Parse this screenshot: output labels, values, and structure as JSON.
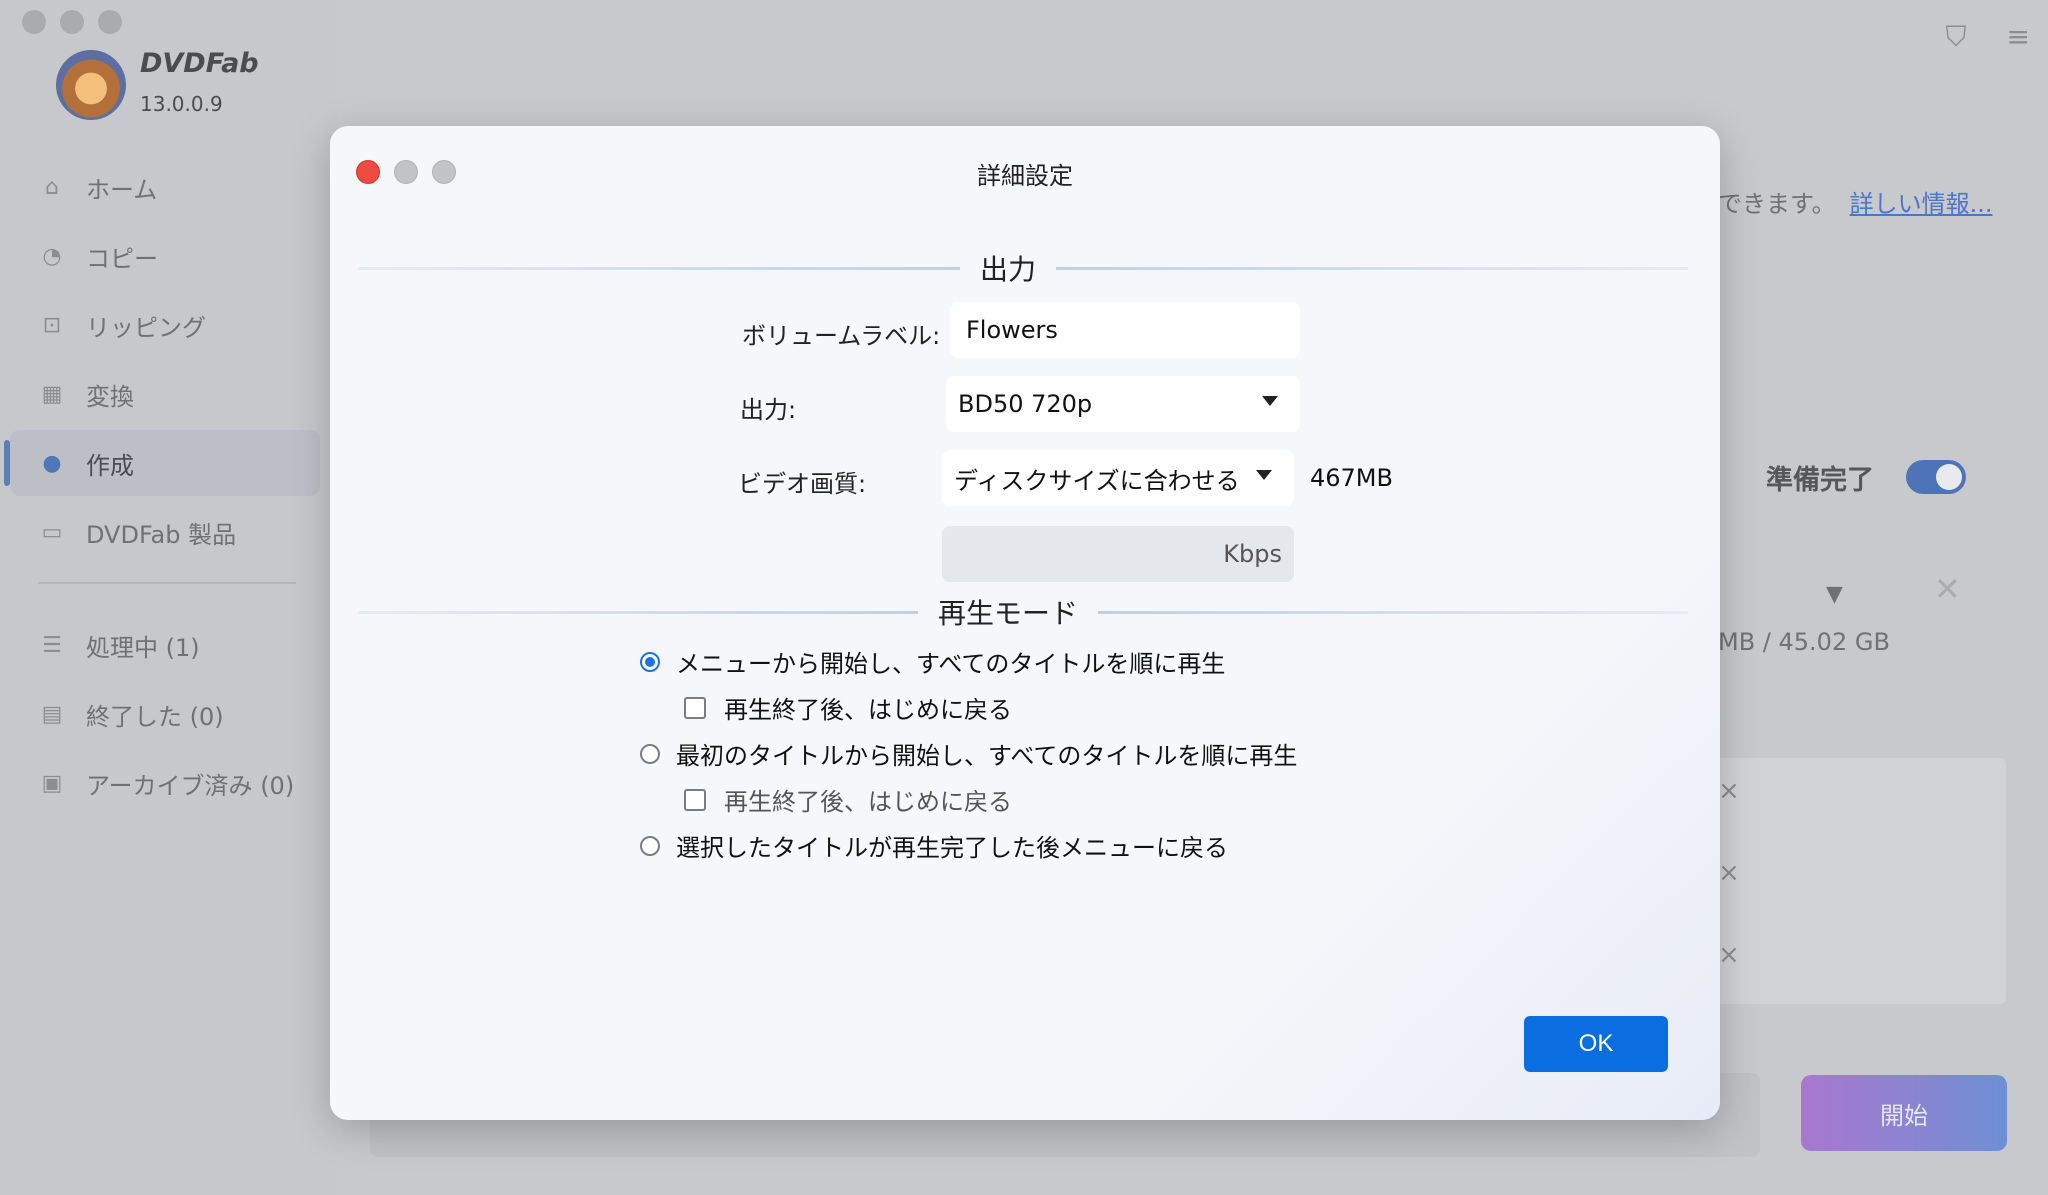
{
  "app": {
    "brand": "DVDFab",
    "version": "13.0.0.9",
    "nav": [
      {
        "label": "ホーム",
        "icon": "⌂"
      },
      {
        "label": "コピー",
        "icon": "◔"
      },
      {
        "label": "リッピング",
        "icon": "⊡"
      },
      {
        "label": "変換",
        "icon": "▦"
      },
      {
        "label": "作成",
        "icon": "●"
      },
      {
        "label": "DVDFab 製品",
        "icon": "▭"
      }
    ],
    "queue": [
      {
        "label": "処理中 (1)",
        "icon": "☰"
      },
      {
        "label": "終了した (0)",
        "icon": "▤"
      },
      {
        "label": "アーカイブ済み (0)",
        "icon": "▣"
      }
    ],
    "info_text": "できます。",
    "info_link": "詳しい情報...",
    "ready_label": "準備完了",
    "size_text": "MB / 45.02 GB",
    "start_label": "開始"
  },
  "dialog": {
    "title": "詳細設定",
    "output_section": "出力",
    "volume_label": "ボリュームラベル:",
    "volume_value": "Flowers",
    "output_label": "出力:",
    "output_value": "BD50 720p",
    "quality_label": "ビデオ画質:",
    "quality_value": "ディスクサイズに合わせる",
    "size_value": "467MB",
    "kbps_unit": "Kbps",
    "play_section": "再生モード",
    "options": [
      "メニューから開始し、すべてのタイトルを順に再生",
      "再生終了後、はじめに戻る",
      "最初のタイトルから開始し、すべてのタイトルを順に再生",
      "再生終了後、はじめに戻る",
      "選択したタイトルが再生完了した後メニューに戻る"
    ],
    "ok_label": "OK"
  }
}
